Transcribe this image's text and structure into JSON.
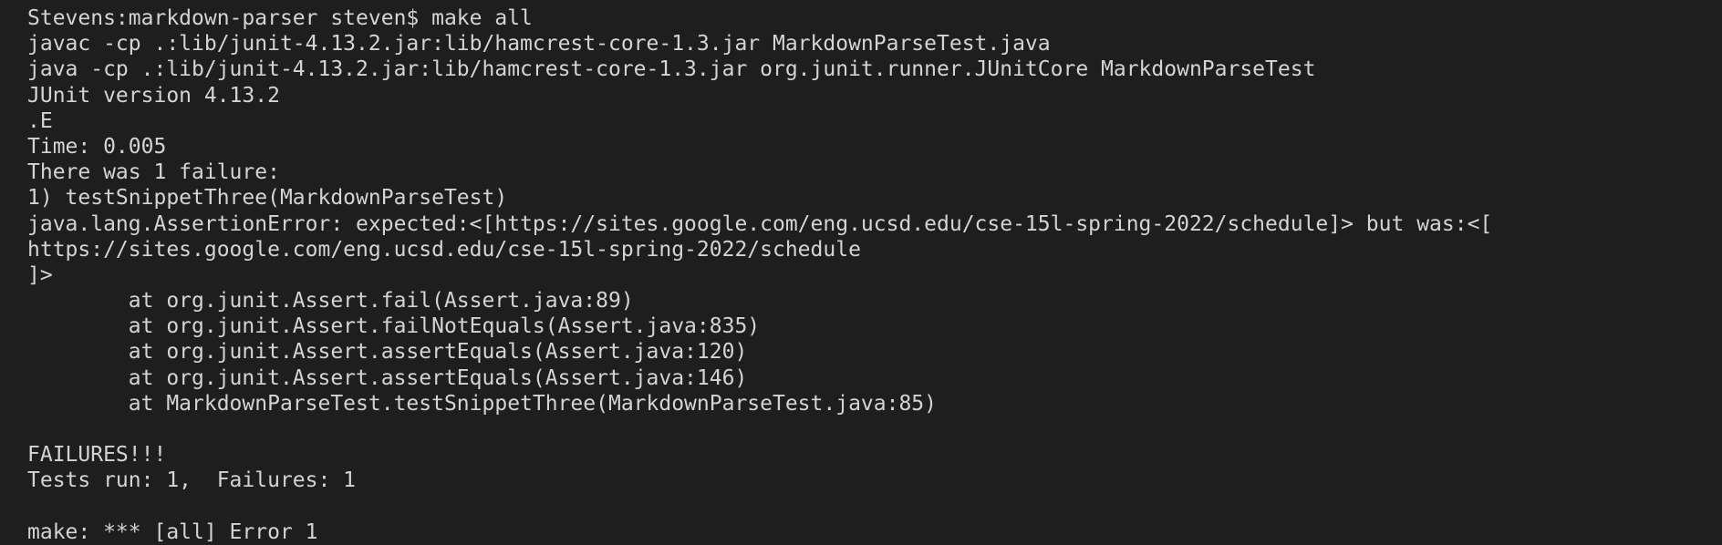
{
  "terminal": {
    "lines": [
      "Stevens:markdown-parser steven$ make all",
      "javac -cp .:lib/junit-4.13.2.jar:lib/hamcrest-core-1.3.jar MarkdownParseTest.java",
      "java -cp .:lib/junit-4.13.2.jar:lib/hamcrest-core-1.3.jar org.junit.runner.JUnitCore MarkdownParseTest",
      "JUnit version 4.13.2",
      ".E",
      "Time: 0.005",
      "There was 1 failure:",
      "1) testSnippetThree(MarkdownParseTest)",
      "java.lang.AssertionError: expected:<[https://sites.google.com/eng.ucsd.edu/cse-15l-spring-2022/schedule]> but was:<[",
      "https://sites.google.com/eng.ucsd.edu/cse-15l-spring-2022/schedule",
      "]>",
      "        at org.junit.Assert.fail(Assert.java:89)",
      "        at org.junit.Assert.failNotEquals(Assert.java:835)",
      "        at org.junit.Assert.assertEquals(Assert.java:120)",
      "        at org.junit.Assert.assertEquals(Assert.java:146)",
      "        at MarkdownParseTest.testSnippetThree(MarkdownParseTest.java:85)",
      "",
      "FAILURES!!!",
      "Tests run: 1,  Failures: 1",
      "",
      "make: *** [all] Error 1"
    ]
  },
  "colors": {
    "background": "#1e1e1e",
    "foreground": "#d4d4d4"
  }
}
